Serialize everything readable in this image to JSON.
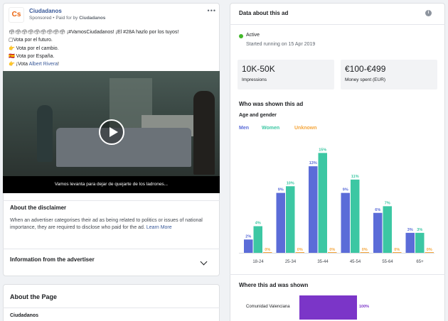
{
  "post": {
    "page_name": "Ciudadanos",
    "logo_text": "Cs",
    "sponsored_prefix": "Sponsored • Paid for by",
    "sponsored_by": "Ciudadanos",
    "text_line1": "🗳🗳🗳🗳🗳🗳🗳🗳🗳 ¡#VamosCiudadanos! ¡El #28A hazlo por los tuyos!",
    "text_line2": "▢Vota por el futuro.",
    "text_line3": "👉 Vota por el cambio.",
    "text_line4": "🇪🇸 Vota por España.",
    "text_line5_prefix": "👉 ¡Vota",
    "text_line5_link": "Albert Rivera",
    "text_line5_suffix": "!",
    "video_caption": "Vamos levanta para dejar de quejarte de los ladrones...",
    "more_icon": "•••"
  },
  "disclaimer": {
    "title": "About the disclaimer",
    "text": "When an advertiser categorises their ad as being related to politics or issues of national importance, they are required to disclose who paid for the ad.",
    "learn_more": "Learn More"
  },
  "advertiser_info": {
    "title": "Information from the advertiser"
  },
  "about_page": {
    "title": "About the Page",
    "page_name": "Ciudadanos"
  },
  "ad_data": {
    "title": "Data about this ad",
    "info_icon": "i",
    "status": "Active",
    "started": "Started running on 15 Apr 2019",
    "impressions_value": "10K-50K",
    "impressions_label": "Impressions",
    "spend_value": "€100-€499",
    "spend_label": "Money spent (EUR)",
    "who_title": "Who was shown this ad",
    "age_gender_title": "Age and gender",
    "where_title": "Where this ad was shown",
    "region": "Comunidad Valenciana",
    "region_pct": "100%",
    "region_fraction": 1.0
  },
  "colors": {
    "men": "#5b6cd8",
    "women": "#3cc7a3",
    "unknown": "#f5a63c",
    "region": "#7b35c8"
  },
  "chart_data": {
    "type": "bar",
    "categories": [
      "18-24",
      "25-34",
      "35-44",
      "45-54",
      "55-64",
      "65+"
    ],
    "series": [
      {
        "name": "Men",
        "values": [
          2,
          9,
          13,
          9,
          6,
          3
        ],
        "labels": [
          "2%",
          "9%",
          "13%",
          "9%",
          "6%",
          "3%"
        ]
      },
      {
        "name": "Women",
        "values": [
          4,
          10,
          15,
          11,
          7,
          3
        ],
        "labels": [
          "4%",
          "10%",
          "15%",
          "11%",
          "7%",
          "3%"
        ]
      },
      {
        "name": "Unknown",
        "values": [
          0,
          0,
          0,
          0,
          0,
          0
        ],
        "labels": [
          "0%",
          "0%",
          "0%",
          "0%",
          "0%",
          "0%"
        ]
      }
    ],
    "ylim": [
      0,
      16
    ]
  }
}
